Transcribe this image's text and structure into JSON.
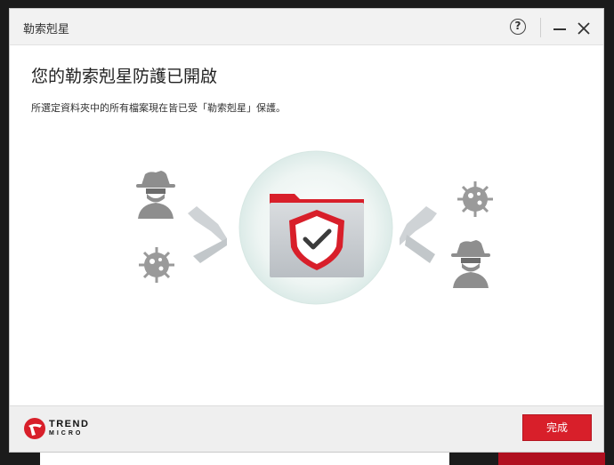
{
  "window": {
    "title": "勒索剋星",
    "help_label": "?",
    "minimize_icon": "minimize-icon",
    "close_icon": "close-icon"
  },
  "main": {
    "heading": "您的勒索剋星防護已開啟",
    "description": "所選定資料夾中的所有檔案現在皆已受「勒索剋星」保護。"
  },
  "illustration": {
    "icons": [
      "hacker-icon",
      "virus-icon",
      "shield-folder-icon",
      "blocked-arrow-icon"
    ],
    "colors": {
      "accent": "#d81f2a",
      "circle": "#e6f1ef",
      "gray_icon": "#9a9a9a"
    }
  },
  "footer": {
    "brand_line1": "TREND",
    "brand_line2": "MICRO",
    "done_label": "完成"
  }
}
